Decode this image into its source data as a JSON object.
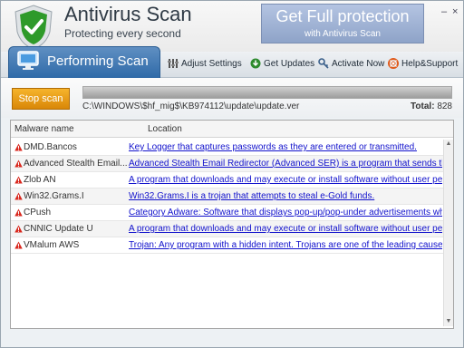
{
  "header": {
    "title": "Antivirus Scan",
    "subtitle": "Protecting every second",
    "promo_line1": "Get Full protection",
    "promo_line2": "with Antivirus Scan",
    "minimize_label": "–",
    "close_label": "×",
    "shield_icon": "shield-check-icon",
    "brand_color": "#2e9a2a"
  },
  "toolbar": {
    "active_tab": "Performing Scan",
    "items": [
      {
        "label": "Adjust Settings",
        "icon": "settings-icon"
      },
      {
        "label": "Get Updates",
        "icon": "update-icon"
      },
      {
        "label": "Activate Now",
        "icon": "key-icon"
      },
      {
        "label": "Help&Support",
        "icon": "lifebuoy-icon"
      }
    ]
  },
  "scan": {
    "stop_label": "Stop scan",
    "progress_percent": 100,
    "current_path": "C:\\WINDOWS\\$hf_mig$\\KB974112\\update\\update.ver",
    "total_label": "Total:",
    "total_value": "828"
  },
  "results": {
    "columns": [
      "Malware name",
      "Location"
    ],
    "warning_icon": "warning-triangle-icon",
    "warning_color": "#d9261c",
    "rows": [
      {
        "name": "DMD.Bancos",
        "location": "Key Logger that captures passwords as they are entered or transmitted."
      },
      {
        "name": "Advanced Stealth Email...",
        "location": "Advanced Stealth Email Redirector (Advanced SER) is a program that sends the"
      },
      {
        "name": "Zlob AN",
        "location": "A program that downloads and may execute or install software without user per"
      },
      {
        "name": "Win32.Grams.I",
        "location": "Win32.Grams.I is a trojan that attempts to steal e-Gold funds."
      },
      {
        "name": "CPush",
        "location": "Category Adware: Software that displays pop-up/pop-under advertisements whe"
      },
      {
        "name": "CNNIC Update U",
        "location": "A program that downloads and may execute or install software without user per"
      },
      {
        "name": "VMalum AWS",
        "location": "Trojan: Any program with a hidden intent. Trojans are one of the leading causes"
      }
    ]
  }
}
